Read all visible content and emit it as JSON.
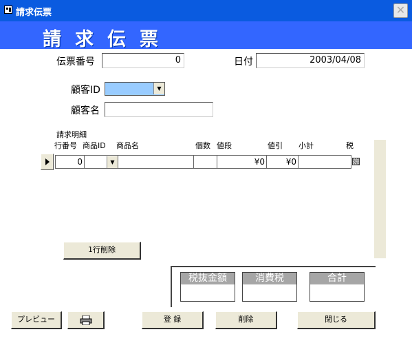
{
  "window": {
    "title": "請求伝票",
    "close_symbol": "✕"
  },
  "banner": {
    "title": "請求伝票"
  },
  "header": {
    "slip_no_label": "伝票番号",
    "slip_no_value": "0",
    "date_label": "日付",
    "date_value": "2003/04/08",
    "customer_id_label": "顧客ID",
    "customer_id_value": "",
    "customer_name_label": "顧客名",
    "customer_name_value": ""
  },
  "details": {
    "section_label": "請求明細",
    "columns": [
      "行番号",
      "商品ID",
      "商品名",
      "個数",
      "値段",
      "値引",
      "小計",
      "税"
    ],
    "row": {
      "line_no": "0",
      "product_id": "",
      "product_name": "",
      "quantity": "",
      "price": "¥0",
      "discount": "¥0",
      "subtotal": ""
    },
    "delete_row_label": "1行削除"
  },
  "summary": {
    "items": [
      {
        "label": "税抜金額",
        "value": ""
      },
      {
        "label": "消費税",
        "value": ""
      },
      {
        "label": "合計",
        "value": ""
      }
    ]
  },
  "footer": {
    "preview_label": "プレビュー",
    "register_label": "登 録",
    "delete_label": "削除",
    "close_label": "閉じる"
  },
  "icons": {
    "print": "printer-icon",
    "record_selector": "triangle-right-icon"
  },
  "colors": {
    "titlebar": "#0a5be0",
    "banner": "#3366ff",
    "combo_highlight": "#99ccff",
    "summary_header": "#a6a6a6"
  }
}
